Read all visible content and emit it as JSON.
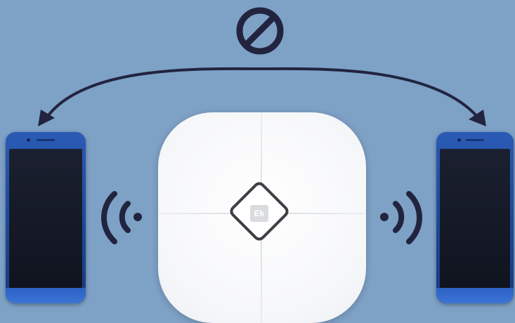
{
  "device": {
    "logo_text": "Ek"
  },
  "icons": {
    "blocked": "prohibited-icon",
    "arrow": "double-headed-arrow-icon",
    "signal_left": "wireless-signal-left-icon",
    "signal_right": "wireless-signal-right-icon"
  },
  "colors": {
    "background": "#7ea1c6",
    "ink": "#22243f",
    "phone_body": "#1d4694",
    "hub_body": "#f6f7f9"
  }
}
